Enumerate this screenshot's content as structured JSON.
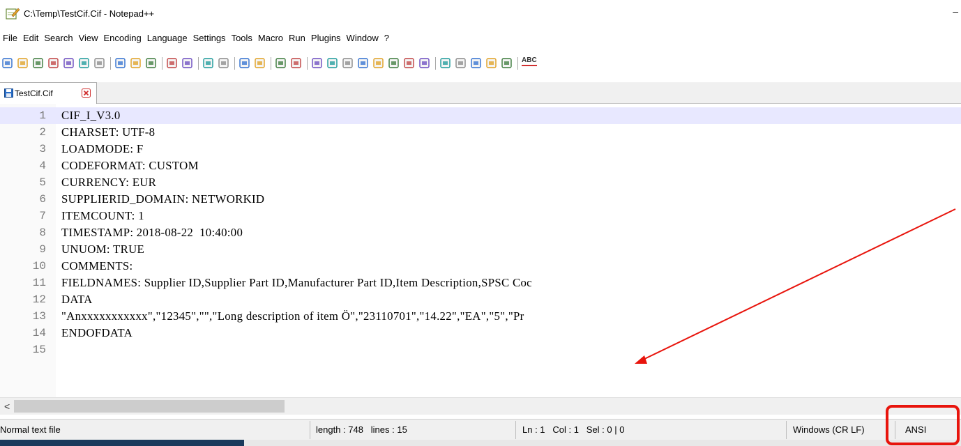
{
  "window": {
    "title": "C:\\Temp\\TestCif.Cif - Notepad++",
    "minimize_glyph": "–"
  },
  "menu": [
    "File",
    "Edit",
    "Search",
    "View",
    "Encoding",
    "Language",
    "Settings",
    "Tools",
    "Macro",
    "Run",
    "Plugins",
    "Window",
    "?"
  ],
  "toolbar": {
    "icons": [
      "new-file-icon",
      "open-file-icon",
      "save-icon",
      "save-all-icon",
      "close-icon",
      "close-all-icon",
      "print-icon",
      "cut-icon",
      "copy-icon",
      "paste-icon",
      "undo-icon",
      "redo-icon",
      "find-icon",
      "replace-icon",
      "zoom-in-icon",
      "zoom-out-icon",
      "sync-vertical-icon",
      "sync-horizontal-icon",
      "word-wrap-icon",
      "show-all-chars-icon",
      "indent-guide-icon",
      "user-language-icon",
      "document-map-icon",
      "function-list-icon",
      "folder-workspace-icon",
      "monitoring-icon",
      "record-macro-icon",
      "stop-record-icon",
      "playback-macro-icon",
      "run-macro-multiple-icon",
      "save-macro-icon",
      "spell-check-icon"
    ],
    "spell_label": "ABC"
  },
  "tab": {
    "label": "TestCif.Cif"
  },
  "editor": {
    "lines": [
      {
        "n": "1",
        "text": "CIF_I_V3.0"
      },
      {
        "n": "2",
        "text": "CHARSET: UTF-8"
      },
      {
        "n": "3",
        "text": "LOADMODE: F"
      },
      {
        "n": "4",
        "text": "CODEFORMAT: CUSTOM"
      },
      {
        "n": "5",
        "text": "CURRENCY: EUR"
      },
      {
        "n": "6",
        "text": "SUPPLIERID_DOMAIN: NETWORKID"
      },
      {
        "n": "7",
        "text": "ITEMCOUNT: 1"
      },
      {
        "n": "8",
        "text": "TIMESTAMP: 2018-08-22  10:40:00"
      },
      {
        "n": "9",
        "text": "UNUOM: TRUE"
      },
      {
        "n": "10",
        "text": "COMMENTS:"
      },
      {
        "n": "11",
        "text": "FIELDNAMES: Supplier ID,Supplier Part ID,Manufacturer Part ID,Item Description,SPSC Coc"
      },
      {
        "n": "12",
        "text": "DATA"
      },
      {
        "n": "13",
        "text": "\"Anxxxxxxxxxxx\",\"12345\",\"\",\"Long description of item Ö\",\"23110701\",\"14.22\",\"EA\",\"5\",\"Pr"
      },
      {
        "n": "14",
        "text": "ENDOFDATA"
      },
      {
        "n": "15",
        "text": ""
      }
    ]
  },
  "hscroll": {
    "left_arrow": "<"
  },
  "status": {
    "file_type": "Normal text file",
    "length_lines": "length : 748   lines : 15",
    "position": "Ln : 1   Col : 1   Sel : 0 | 0",
    "eol": "Windows (CR LF)",
    "encoding": "ANSI"
  },
  "colors": {
    "annotation": "#e8140c",
    "current_line": "#e8e8ff"
  }
}
